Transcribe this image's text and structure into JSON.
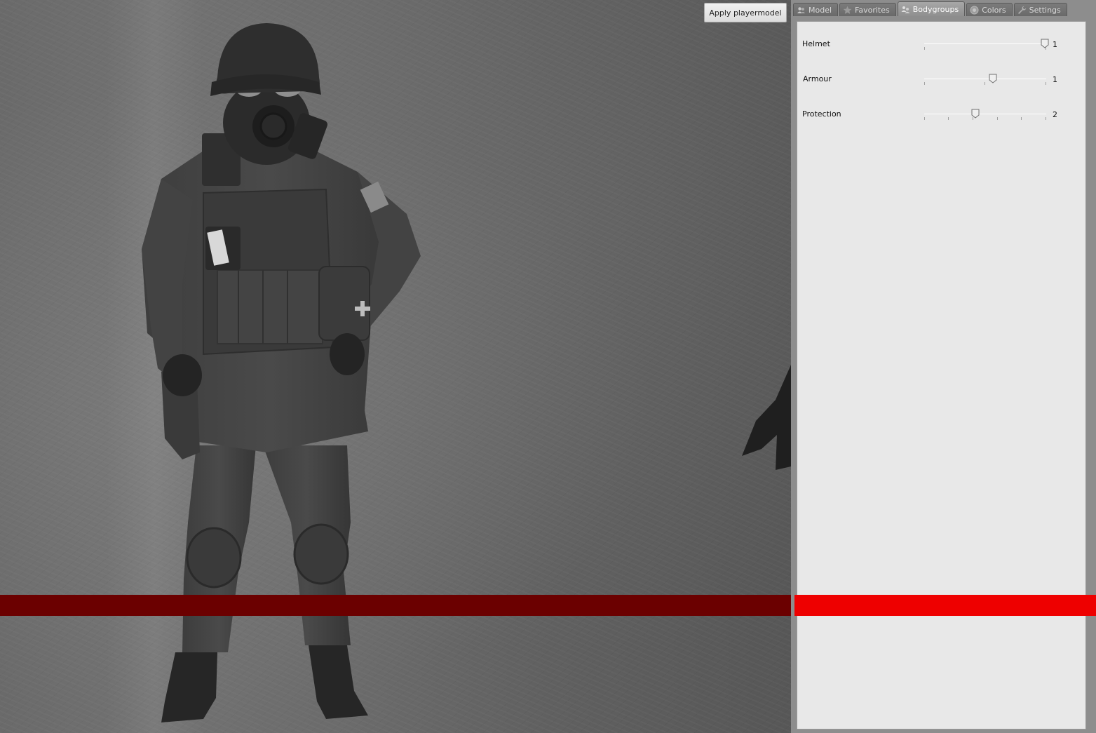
{
  "apply_button": {
    "label": "Apply playermodel"
  },
  "tabs": [
    {
      "label": "Model",
      "icon": "user-icon",
      "active": false
    },
    {
      "label": "Favorites",
      "icon": "star-icon",
      "active": false
    },
    {
      "label": "Bodygroups",
      "icon": "group-icon",
      "active": true
    },
    {
      "label": "Colors",
      "icon": "color-circle-icon",
      "active": false
    },
    {
      "label": "Settings",
      "icon": "wrench-icon",
      "active": false
    }
  ],
  "bodygroups": [
    {
      "label": "Helmet",
      "value": "1",
      "min": 0,
      "max": 1
    },
    {
      "label": "Armour",
      "value": "1",
      "min": 0,
      "max": 2
    },
    {
      "label": "Protection",
      "value": "2",
      "min": 0,
      "max": 5
    }
  ],
  "colors": {
    "panel_bg": "#e8e8e8",
    "stripe_dark": "#6b0000",
    "stripe_bright": "#ee0000"
  }
}
